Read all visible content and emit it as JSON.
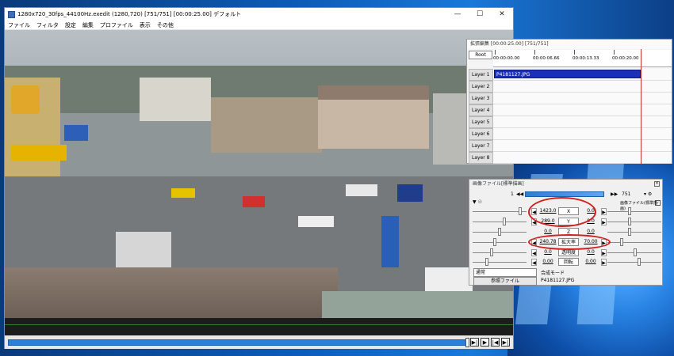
{
  "main_window": {
    "title": "1280x720_30fps_44100Hz.exedit (1280,720)  [751/751]  [00:00:25.00]  デフォルト",
    "controls": {
      "minimize": "—",
      "maximize": "☐",
      "close": "✕"
    },
    "menu": [
      "ファイル",
      "フィルタ",
      "設定",
      "編集",
      "プロファイル",
      "表示",
      "その他"
    ],
    "playback_buttons": [
      "▶|",
      "▶",
      "|◀",
      "▶|"
    ]
  },
  "timeline": {
    "title": "拡張編集 [00:00:25.00] [751/751]",
    "root_label": "Root",
    "ruler_labels": [
      "00:00:00.00",
      "00:00:06.66",
      "00:00:13.33",
      "00:00:20.00"
    ],
    "layers": [
      "Layer 1",
      "Layer 2",
      "Layer 3",
      "Layer 4",
      "Layer 5",
      "Layer 6",
      "Layer 7",
      "Layer 8"
    ],
    "clip_label": "P4181127.JPG"
  },
  "properties": {
    "title": "画像ファイル[標準描画]",
    "frame_start": "1",
    "frame_end": "751",
    "filter_labels": [
      "画像ファイル(標準描画)"
    ],
    "rows": [
      {
        "left": "1423.0",
        "name": "X",
        "right": "0.0"
      },
      {
        "left": "289.0",
        "name": "Y",
        "right": "0.0"
      },
      {
        "left": "0.0",
        "name": "Z",
        "right": "0.0"
      },
      {
        "left": "240.78",
        "name": "拡大率",
        "right": "70.00"
      },
      {
        "left": "0.0",
        "name": "透明度",
        "right": "0.0"
      },
      {
        "left": "0.00",
        "name": "回転",
        "right": "0.00"
      }
    ],
    "blend_mode": "通常",
    "blend_label": "合成モード",
    "ref_button": "参照ファイル",
    "file_name": "P4181127.JPG"
  },
  "colors": {
    "clip": "#1c2fb8",
    "cursor": "#c0392b",
    "highlight": "#d21e1e"
  }
}
